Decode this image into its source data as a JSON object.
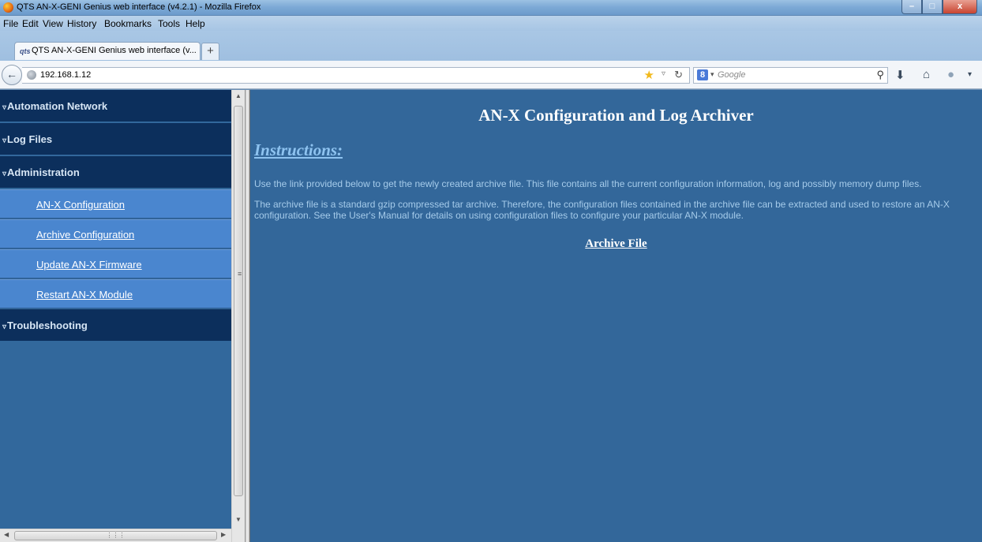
{
  "window": {
    "title": "QTS AN-X-GENI Genius web interface (v4.2.1) - Mozilla Firefox",
    "min_glyph": "–",
    "max_glyph": "□",
    "close_glyph": "x"
  },
  "menu": [
    "File",
    "Edit",
    "View",
    "History",
    "Bookmarks",
    "Tools",
    "Help"
  ],
  "tab": {
    "label": "QTS AN-X-GENI Genius web interface (v...",
    "icon_text": "qts",
    "new_tab": "+"
  },
  "navbar": {
    "url": "192.168.1.12",
    "search_placeholder": "Google",
    "search_engine_glyph": "8"
  },
  "sidebar": {
    "sections": [
      {
        "label": "Automation Network"
      },
      {
        "label": "Log Files"
      },
      {
        "label": "Administration"
      },
      {
        "label": "Troubleshooting"
      }
    ],
    "admin_items": [
      {
        "label": "AN-X Configuration"
      },
      {
        "label": "Archive Configuration"
      },
      {
        "label": "Update AN-X Firmware"
      },
      {
        "label": "Restart AN-X Module"
      }
    ]
  },
  "main": {
    "heading": "AN-X Configuration and Log Archiver",
    "instructions_title": "Instructions:",
    "paragraph1": "Use the link provided below to get the newly created archive file. This file contains all the current configuration information, log and possibly memory dump files.",
    "paragraph2": "The archive file is a standard gzip compressed tar archive. Therefore, the configuration files contained in the archive file can be extracted and used to restore an AN-X configuration. See the User's Manual for details on using configuration files to configure your particular AN-X module.",
    "archive_link": "Archive File"
  },
  "colors": {
    "sidebar_header": "#0c2f5c",
    "sidebar_item": "#4a86cf",
    "main_bg": "#33679a",
    "text": "#a5cbea"
  }
}
